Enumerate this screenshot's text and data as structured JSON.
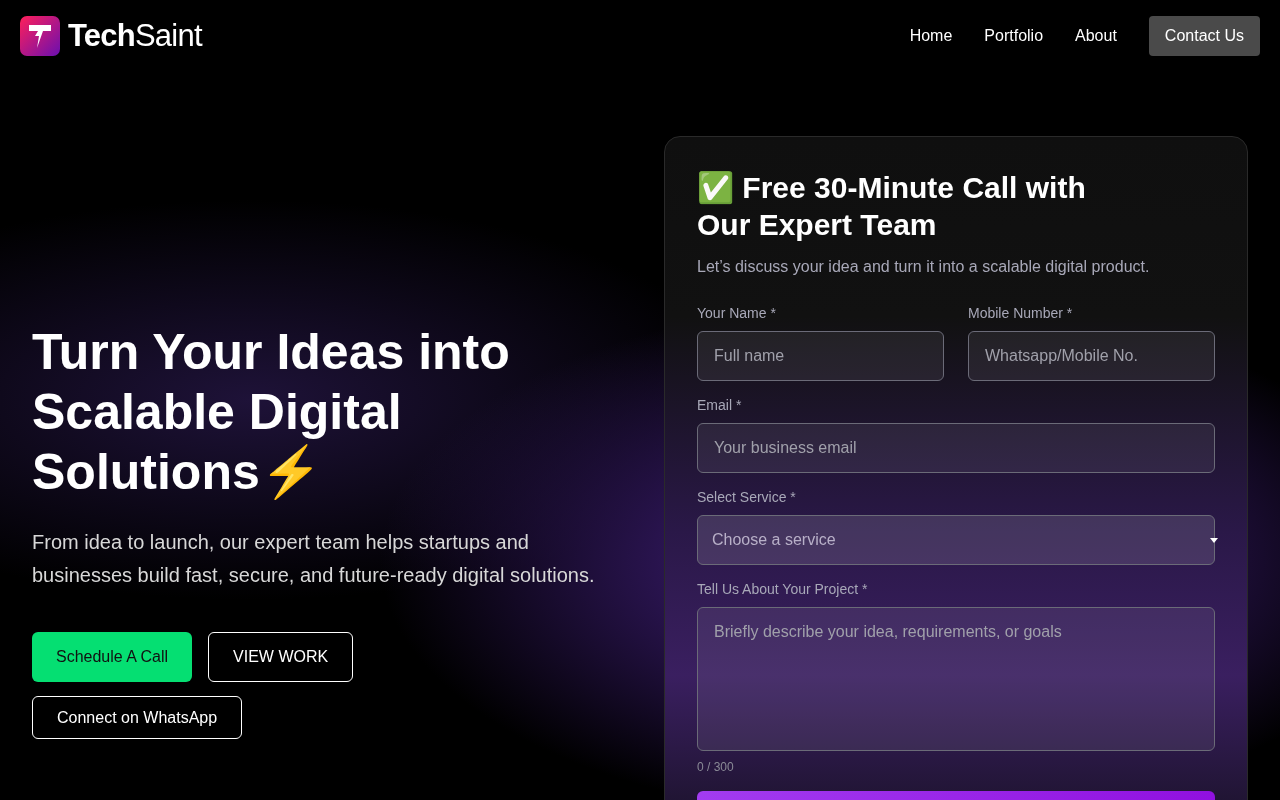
{
  "brand": {
    "name_bold": "Tech",
    "name_light": "Saint"
  },
  "nav": [
    {
      "label": "Home",
      "kind": "link"
    },
    {
      "label": "Portfolio",
      "kind": "link"
    },
    {
      "label": "About",
      "kind": "link"
    },
    {
      "label": "Contact Us",
      "kind": "button"
    }
  ],
  "hero": {
    "headline": "Turn Your Ideas into Scalable Digital Solutions⚡",
    "subtext": "From idea to launch, our expert team helps startups and businesses build fast, secure, and future-ready digital solutions.",
    "buttons": [
      {
        "label": "Schedule A Call",
        "kind": "primary"
      },
      {
        "label": "VIEW WORK",
        "kind": "outline"
      },
      {
        "label": "Connect on WhatsApp",
        "kind": "outline"
      }
    ]
  },
  "form": {
    "title": "✅ Free 30-Minute Call with Our Expert Team",
    "subtitle": "Let’s discuss your idea and turn it into a scalable digital product.",
    "fields": [
      {
        "label": "Your Name *",
        "placeholder": "Full name",
        "kind": "input"
      },
      {
        "label": "Mobile Number *",
        "placeholder": "Whatsapp/Mobile No.",
        "kind": "input"
      },
      {
        "label": "Email *",
        "placeholder": "Your business email",
        "kind": "input"
      },
      {
        "label": "Select Service *",
        "placeholder": "Choose a service",
        "kind": "select"
      },
      {
        "label": "Tell Us About Your Project *",
        "placeholder": "Briefly describe your idea, requirements, or goals",
        "kind": "textarea"
      }
    ],
    "counter": "0 / 300"
  }
}
